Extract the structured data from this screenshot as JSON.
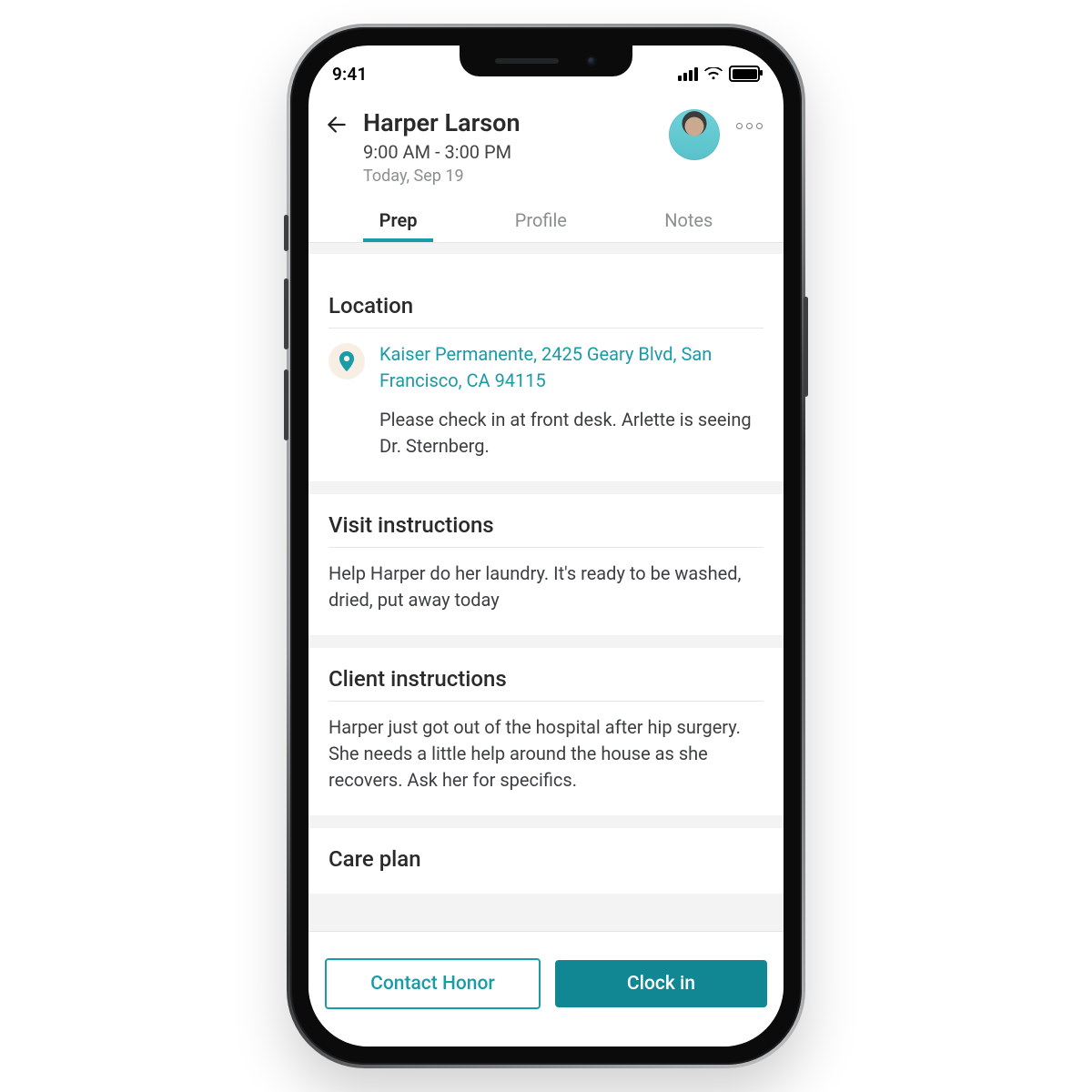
{
  "statusbar": {
    "time": "9:41"
  },
  "header": {
    "client_name": "Harper Larson",
    "time_range": "9:00 AM - 3:00 PM",
    "date_line": "Today, Sep 19"
  },
  "tabs": [
    {
      "label": "Prep",
      "active": true
    },
    {
      "label": "Profile",
      "active": false
    },
    {
      "label": "Notes",
      "active": false
    }
  ],
  "sections": {
    "location": {
      "title": "Location",
      "address": "Kaiser Permanente, 2425 Geary Blvd, San Francisco, CA 94115",
      "note": "Please check in at front desk. Arlette is seeing Dr. Sternberg."
    },
    "visit_instructions": {
      "title": "Visit instructions",
      "body": "Help Harper do her laundry. It's ready to be washed, dried, put away today"
    },
    "client_instructions": {
      "title": "Client instructions",
      "body": "Harper just got out of the hospital after hip surgery. She needs a little help around the house as she recovers. Ask her for specifics."
    },
    "care_plan": {
      "title": "Care plan"
    }
  },
  "actions": {
    "contact_label": "Contact Honor",
    "clockin_label": "Clock in"
  },
  "icons": {
    "back": "back-arrow-icon",
    "more": "more-icon",
    "pin": "map-pin-icon",
    "signal": "cell-signal-icon",
    "wifi": "wifi-icon",
    "battery": "battery-icon"
  },
  "colors": {
    "teal": "#1a9ba8",
    "cream": "#f7efe3"
  }
}
